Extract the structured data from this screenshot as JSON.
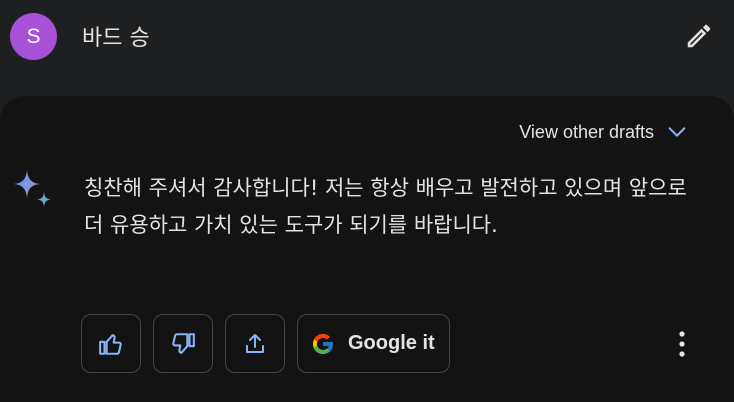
{
  "prompt": {
    "avatar_initial": "S",
    "avatar_color": "#a651d6",
    "text": "바드 승",
    "edit_icon": "pencil-icon"
  },
  "response": {
    "drafts_label": "View other drafts",
    "drafts_icon": "chevron-down-icon",
    "logo_icon": "sparkle-icon",
    "text": "칭찬해 주셔서 감사합니다! 저는 항상 배우고 발전하고 있으며 앞으로 더 유용하고 가치 있는 도구가 되기를 바랍니다.",
    "actions": {
      "thumbs_up_icon": "thumbs-up-icon",
      "thumbs_down_icon": "thumbs-down-icon",
      "share_icon": "share-icon",
      "google_icon": "google-logo-icon",
      "google_label": "Google it",
      "more_icon": "more-vertical-icon"
    }
  },
  "colors": {
    "background": "#1e1f20",
    "card": "#131314",
    "accent_blue": "#8ab4f8",
    "text": "#e3e3e3"
  }
}
